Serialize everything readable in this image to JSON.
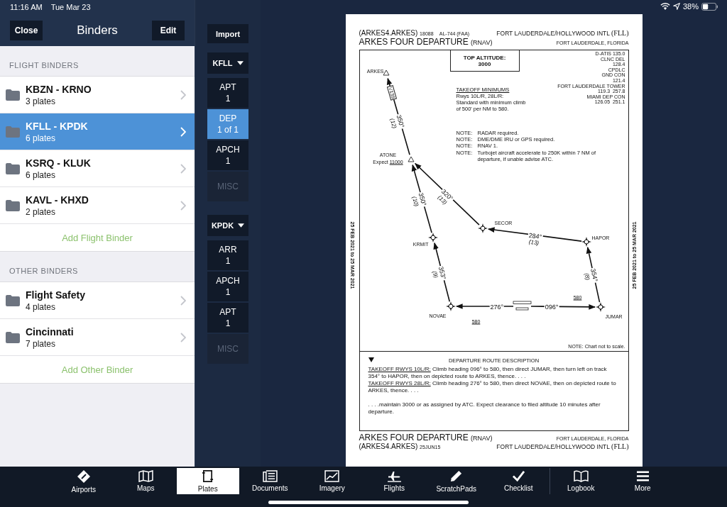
{
  "status_bar": {
    "time": "11:16 AM",
    "date": "Tue Mar 23",
    "battery": "38%"
  },
  "binders_panel": {
    "title": "Binders",
    "close_button": "Close",
    "edit_button": "Edit",
    "sections": [
      {
        "heading": "FLIGHT BINDERS",
        "add_label": "Add Flight Binder",
        "items": [
          {
            "name": "KBZN - KRNO",
            "count": "3 plates",
            "selected": false
          },
          {
            "name": "KFLL - KPDK",
            "count": "6 plates",
            "selected": true
          },
          {
            "name": "KSRQ - KLUK",
            "count": "6 plates",
            "selected": false
          },
          {
            "name": "KAVL - KHXD",
            "count": "2 plates",
            "selected": false
          }
        ]
      },
      {
        "heading": "OTHER BINDERS",
        "add_label": "Add Other Binder",
        "items": [
          {
            "name": "Flight Safety",
            "count": "4 plates",
            "selected": false
          },
          {
            "name": "Cincinnati",
            "count": "7 plates",
            "selected": false
          }
        ]
      }
    ]
  },
  "plate_nav": {
    "import_button": "Import",
    "airports": [
      {
        "code": "KFLL",
        "categories": [
          {
            "label": "APT",
            "count": "1",
            "selected": false,
            "disabled": false
          },
          {
            "label": "DEP",
            "count": "1 of 1",
            "selected": true,
            "disabled": false
          },
          {
            "label": "APCH",
            "count": "1",
            "selected": false,
            "disabled": false
          },
          {
            "label": "MISC",
            "selected": false,
            "disabled": true
          }
        ]
      },
      {
        "code": "KPDK",
        "categories": [
          {
            "label": "ARR",
            "count": "1",
            "selected": false,
            "disabled": false
          },
          {
            "label": "APCH",
            "count": "1",
            "selected": false,
            "disabled": false
          },
          {
            "label": "APT",
            "count": "1",
            "selected": false,
            "disabled": false
          },
          {
            "label": "MISC",
            "selected": false,
            "disabled": true
          }
        ]
      }
    ]
  },
  "plate": {
    "header": {
      "procedure_code": "(ARKES4.ARKES)",
      "number": "18088",
      "chart_id": "AL-744 (FAA)",
      "title": "ARKES FOUR DEPARTURE",
      "title_suffix": "(RNAV)",
      "airport": "FORT LAUDERDALE/HOLLYWOOD INTL",
      "airport_code": "(FLL)",
      "city": "FORT LAUDERDALE, FLORIDA"
    },
    "validity": [
      "25 FEB 2021 to 25 MAR 2021",
      "25 FEB 2021 to 25 MAR 2021"
    ],
    "top_altitude": {
      "label": "TOP ALTITUDE:",
      "value": "3000"
    },
    "frequencies": [
      "D-ATIS 135.0",
      "CLNC DEL",
      "128.4",
      "CPDLC",
      "GND CON",
      "121.4",
      "FORT LAUDERDALE TOWER",
      "119.3  257.8",
      "MIAMI DEP CON",
      "126.05  251.1"
    ],
    "takeoff_minimums": {
      "heading": "TAKEOFF MINIMUMS",
      "lines": [
        "Rwys 10L/R, 28L/R:",
        "Standard with minimum climb",
        "of 500' per NM to 580."
      ]
    },
    "notes": [
      {
        "label": "NOTE:",
        "text": "RADAR required."
      },
      {
        "label": "NOTE:",
        "text": "DME/DME IRU or GPS required."
      },
      {
        "label": "NOTE:",
        "text": "RNAV 1."
      },
      {
        "label": "NOTE:",
        "text": "Turbojet aircraft accelerate to 250K within 7 NM of departure, if unable advise ATC."
      }
    ],
    "waypoints": [
      {
        "name": "ARKES",
        "kind": "triangle"
      },
      {
        "name": "ATONE",
        "kind": "triangle",
        "expect_label": "Expect",
        "expect_altitude": "11000"
      },
      {
        "name": "KRMIT",
        "kind": "waypoint"
      },
      {
        "name": "SECOR",
        "kind": "waypoint"
      },
      {
        "name": "HAPOR",
        "kind": "waypoint"
      },
      {
        "name": "NOVAE",
        "kind": "waypoint"
      },
      {
        "name": "JUMAR",
        "kind": "waypoint"
      }
    ],
    "legs": [
      {
        "course": "350°",
        "distance": "(12)"
      },
      {
        "course": "350°",
        "distance": "(10)"
      },
      {
        "course": "320°",
        "distance": "(13)"
      },
      {
        "course": "284°",
        "distance": "(13)"
      },
      {
        "course": "353°",
        "distance": "(9)"
      },
      {
        "course": "354°",
        "distance": "(8)"
      },
      {
        "course": "276°"
      },
      {
        "course": "096°"
      }
    ],
    "airway": "V139",
    "altitude_restrictions": [
      "580",
      "580"
    ],
    "scale_note": "NOTE: Chart not to scale.",
    "description": {
      "heading": "DEPARTURE ROUTE DESCRIPTION",
      "paragraphs": [
        {
          "label": "TAKEOFF RWYS 10L/R:",
          "text": "Climb heading 096° to 580, then direct JUMAR, then turn left on track 354° to HAPOR, then on depicted route to ARKES, thence. . . ."
        },
        {
          "label": "TAKEOFF RWYS 28L/R:",
          "text": "Climb heading 276° to 580, then direct NOVAE, then on depicted route to ARKES, thence. . . ."
        },
        {
          "text": ". . . .maintain 3000 or as assigned by ATC. Expect clearance to filed altitude 10 minutes after departure."
        }
      ]
    },
    "footer": {
      "title": "ARKES FOUR DEPARTURE",
      "title_suffix": "(RNAV)",
      "procedure_code": "(ARKES4.ARKES)",
      "amendment": "25JUN15",
      "city": "FORT LAUDERDALE, FLORIDA",
      "airport": "FORT LAUDERDALE/HOLLYWOOD INTL",
      "airport_code": "(FLL)"
    }
  },
  "tab_bar": [
    {
      "label": "Airports",
      "selected": false
    },
    {
      "label": "Maps",
      "selected": false
    },
    {
      "label": "Plates",
      "selected": true
    },
    {
      "label": "Documents",
      "selected": false
    },
    {
      "label": "Imagery",
      "selected": false
    },
    {
      "label": "Flights",
      "selected": false
    },
    {
      "label": "ScratchPads",
      "selected": false
    },
    {
      "label": "Checklist",
      "selected": false
    },
    {
      "label": "Logbook",
      "selected": false
    },
    {
      "label": "More",
      "selected": false
    }
  ]
}
